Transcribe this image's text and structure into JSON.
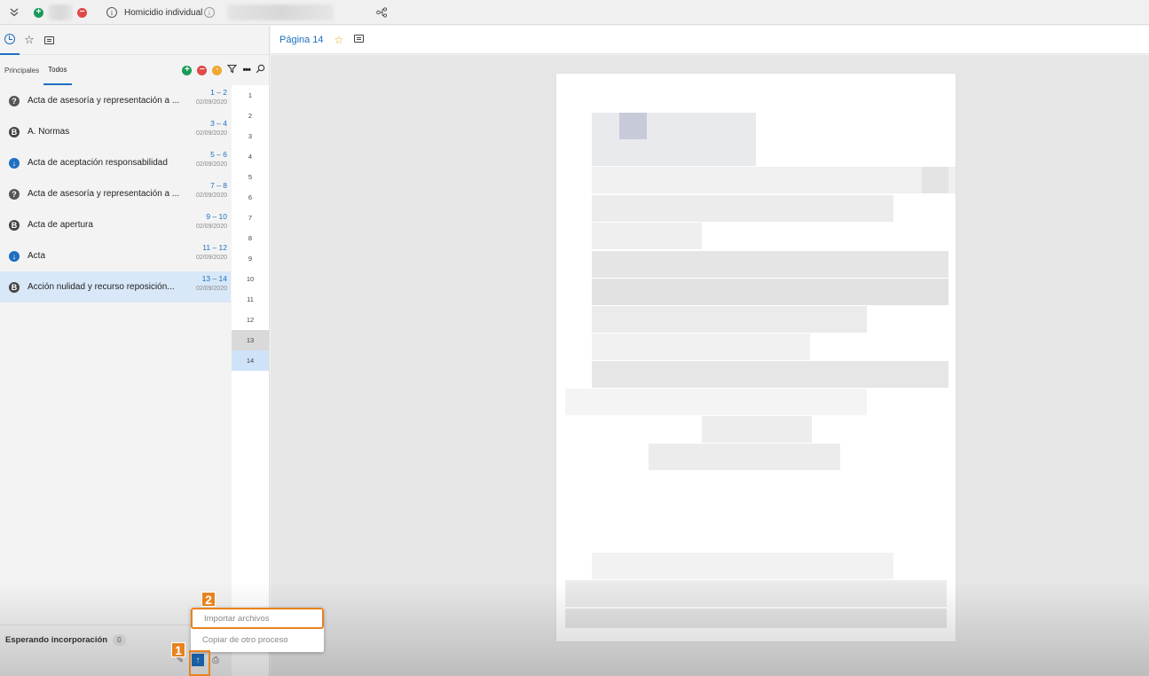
{
  "topbar": {
    "case_title": "Homicidio individual",
    "info_symbol": "i"
  },
  "left_tabs": [
    "recent-clock",
    "favorites-star",
    "comments"
  ],
  "filter_tabs": [
    "Principales",
    "Todos"
  ],
  "documents": [
    {
      "title": "Acta de asesoría y representación a ...",
      "pages": "1 – 2",
      "date": "02/09/2020",
      "icon": "question-icon"
    },
    {
      "title": "A. Normas",
      "pages": "3 – 4",
      "date": "02/09/2020",
      "icon": "b-icon"
    },
    {
      "title": "Acta de aceptación responsabilidad",
      "pages": "5 – 6",
      "date": "02/09/2020",
      "icon": "download-icon"
    },
    {
      "title": "Acta de asesoría y representación a ...",
      "pages": "7 – 8",
      "date": "02/09/2020",
      "icon": "question-icon"
    },
    {
      "title": "Acta de apertura",
      "pages": "9 – 10",
      "date": "02/09/2020",
      "icon": "b-icon"
    },
    {
      "title": "Acta",
      "pages": "11 – 12",
      "date": "02/09/2020",
      "icon": "download-icon"
    },
    {
      "title": "Acción nulidad y recurso reposición...",
      "pages": "13 – 14",
      "date": "02/09/2020",
      "icon": "b-icon"
    }
  ],
  "page_numbers": [
    "1",
    "2",
    "3",
    "4",
    "5",
    "6",
    "7",
    "8",
    "9",
    "10",
    "11",
    "12",
    "13",
    "14"
  ],
  "waiting": {
    "label": "Esperando incorporación",
    "count": "0"
  },
  "main": {
    "page_title": "Página 14"
  },
  "menu": {
    "import": "Importar archivos",
    "copy": "Copiar de otro proceso"
  },
  "callouts": {
    "one": "1",
    "two": "2"
  },
  "colors": {
    "accent": "#1e6fc1",
    "highlight": "#e8821e",
    "selected_row": "#d8e8f8"
  }
}
